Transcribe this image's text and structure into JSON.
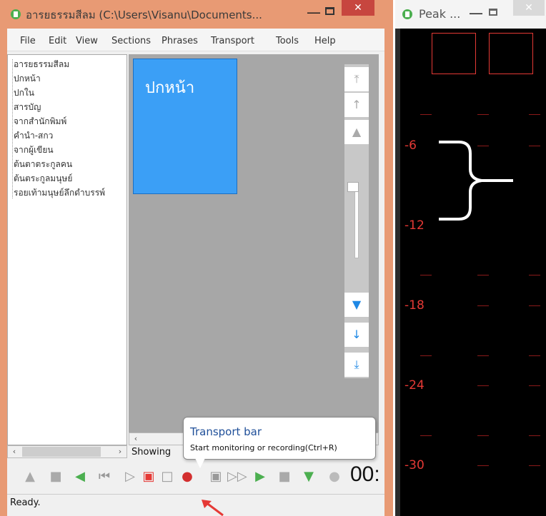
{
  "main_window": {
    "title": "อารยธรรมสีลม (C:\\Users\\Visanu\\Documents...",
    "colors": {
      "frame": "#e89a74",
      "close": "#c7463f",
      "tile": "#3b9ff6",
      "content_bg": "#a7a7a7"
    },
    "controls": {
      "minimize": "—",
      "close": "✕"
    }
  },
  "menu": [
    "File",
    "Edit",
    "View",
    "Sections",
    "Phrases",
    "Transport",
    "Tools",
    "Help"
  ],
  "tree": {
    "items": [
      "อารยธรรมสีลม",
      "ปกหน้า",
      "ปกใน",
      "สารบัญ",
      "จากสำนักพิมพ์",
      "คำนำ-สกว",
      "จากผู้เขียน",
      "ต้นตาตระกูลคน",
      "ต้นตระกูลมนุษย์",
      "รอยเท้ามนุษย์ลึกดำบรรพ์"
    ]
  },
  "content": {
    "tile_label": "ปกหน้า",
    "showing_text": "Showing",
    "right_buttons": [
      "⤒",
      "↑",
      "▲",
      "▼",
      "↓",
      "⤓"
    ]
  },
  "tooltip": {
    "title": "Transport bar",
    "description": "Start monitoring or recording(Ctrl+R)"
  },
  "transport": {
    "timer": "00:",
    "icons": [
      "nav-up-icon",
      "square-icon",
      "arrow-left-icon",
      "rewind-icon",
      "play-icon",
      "mark-icon",
      "stop-icon",
      "record-icon",
      "pause-icon",
      "fast-forward-icon",
      "arrow-right-icon",
      "square2-icon",
      "arrow-down-icon",
      "info-icon"
    ]
  },
  "status": {
    "text": "Ready."
  },
  "peak_window": {
    "title": "Peak ...",
    "db_labels": [
      "-6",
      "-12",
      "-18",
      "-24",
      "-30"
    ],
    "colors": {
      "label": "#e53935",
      "bg": "#000000"
    }
  }
}
